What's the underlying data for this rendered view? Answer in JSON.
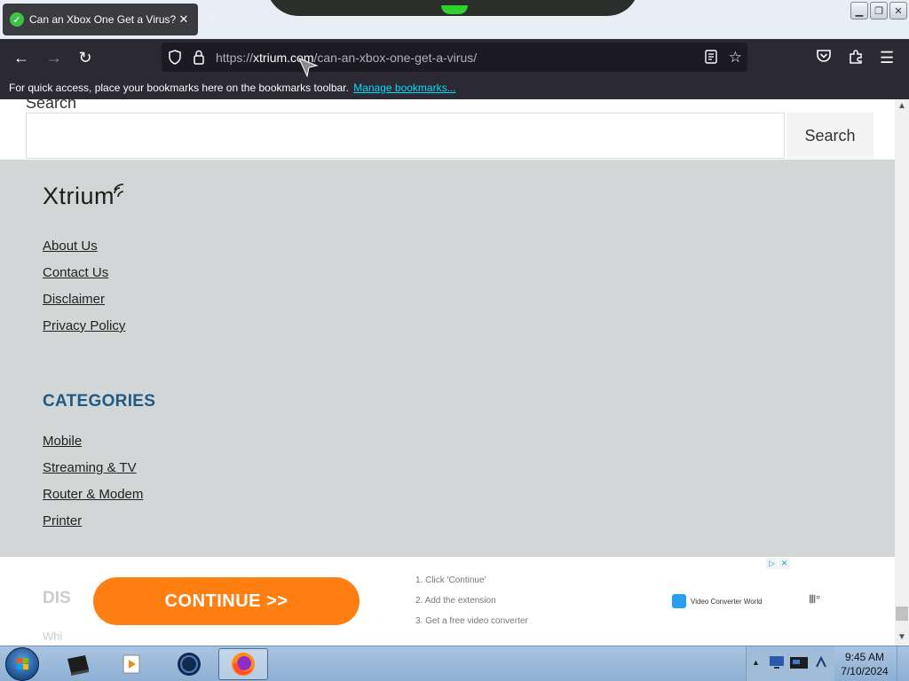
{
  "browser": {
    "tab_title": "Can an Xbox One Get a Virus? -",
    "url_prefix": "https://",
    "url_host": "xtrium.com",
    "url_path": "/can-an-xbox-one-get-a-virus/",
    "bookmarks_message": "For quick access, place your bookmarks here on the bookmarks toolbar.",
    "manage_bookmarks": "Manage bookmarks..."
  },
  "search": {
    "label": "Search",
    "input_value": "",
    "button_label": "Search"
  },
  "footer": {
    "logo": "Xtrium",
    "links": [
      "About Us",
      "Contact Us",
      "Disclaimer",
      "Privacy Policy"
    ],
    "categories_title": "CATEGORIES",
    "categories": [
      "Mobile",
      "Streaming & TV",
      "Router & Modem",
      "Printer"
    ],
    "background_color": "#d3d6d6",
    "category_title_color": "#1f5a87"
  },
  "below_content": {
    "heading_fragment": "DIS",
    "text_fragment": "Whi"
  },
  "ad": {
    "continue_label": "CONTINUE >>",
    "steps": [
      "1. Click 'Continue'",
      "2. Add the extension",
      "3. Get a free video converter"
    ],
    "brand": "Video Converter World",
    "continue_color": "#ff7f12"
  },
  "taskbar": {
    "time": "9:45 AM",
    "date": "7/10/2024"
  }
}
